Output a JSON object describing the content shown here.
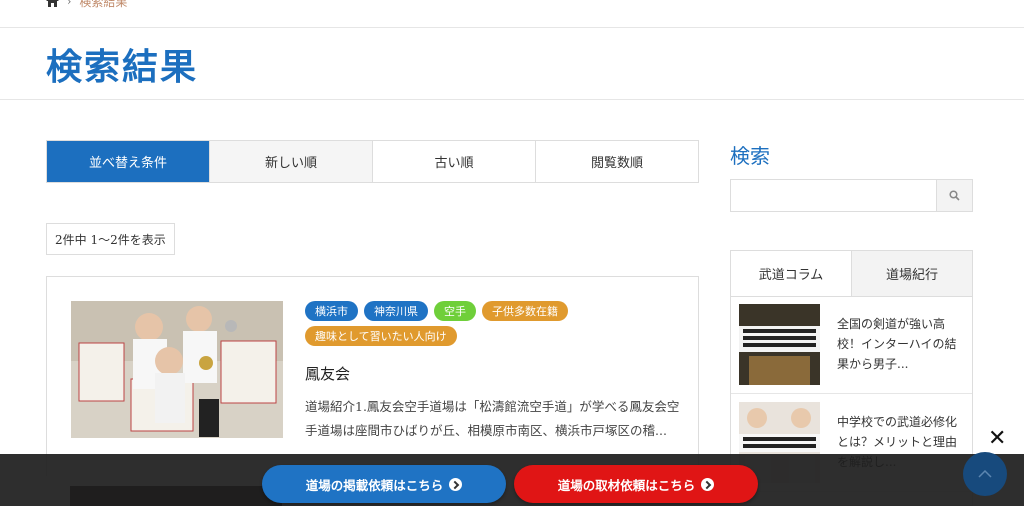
{
  "breadcrumb": {
    "current": "検索結果"
  },
  "page": {
    "title": "検索結果"
  },
  "sort": {
    "tabs": [
      {
        "label": "並べ替え条件"
      },
      {
        "label": "新しい順"
      },
      {
        "label": "古い順"
      },
      {
        "label": "閲覧数順"
      }
    ]
  },
  "results": {
    "count_text": "2件中 1〜2件を表示"
  },
  "card": {
    "tags": [
      {
        "label": "横浜市",
        "color": "#1f73c4"
      },
      {
        "label": "神奈川県",
        "color": "#1f73c4"
      },
      {
        "label": "空手",
        "color": "#6fcf3a"
      },
      {
        "label": "子供多数在籍",
        "color": "#e09a2e"
      },
      {
        "label": "趣味として習いたい人向け",
        "color": "#e09a2e"
      }
    ],
    "title": "鳳友会",
    "excerpt": "道場紹介1.鳳友会空手道場は「松濤館流空手道」が学べる鳳友会空手道場は座間市ひばりが丘、相模原市南区、横浜市戸塚区の稽..."
  },
  "sidebar": {
    "search_title": "検索",
    "search_placeholder": "",
    "tabs": [
      {
        "label": "武道コラム"
      },
      {
        "label": "道場紀行"
      }
    ],
    "items": [
      {
        "text": "全国の剣道が強い高校！インターハイの結果から男子..."
      },
      {
        "text": "中学校での武道必修化とは？メリットと理由を解説し..."
      }
    ]
  },
  "footer_bar": {
    "blue_label": "道場の掲載依頼はこちら",
    "red_label": "道場の取材依頼はこちら"
  },
  "colors": {
    "accent": "#1c6fbf",
    "cta_blue": "#1f73c4",
    "cta_red": "#e01515"
  }
}
